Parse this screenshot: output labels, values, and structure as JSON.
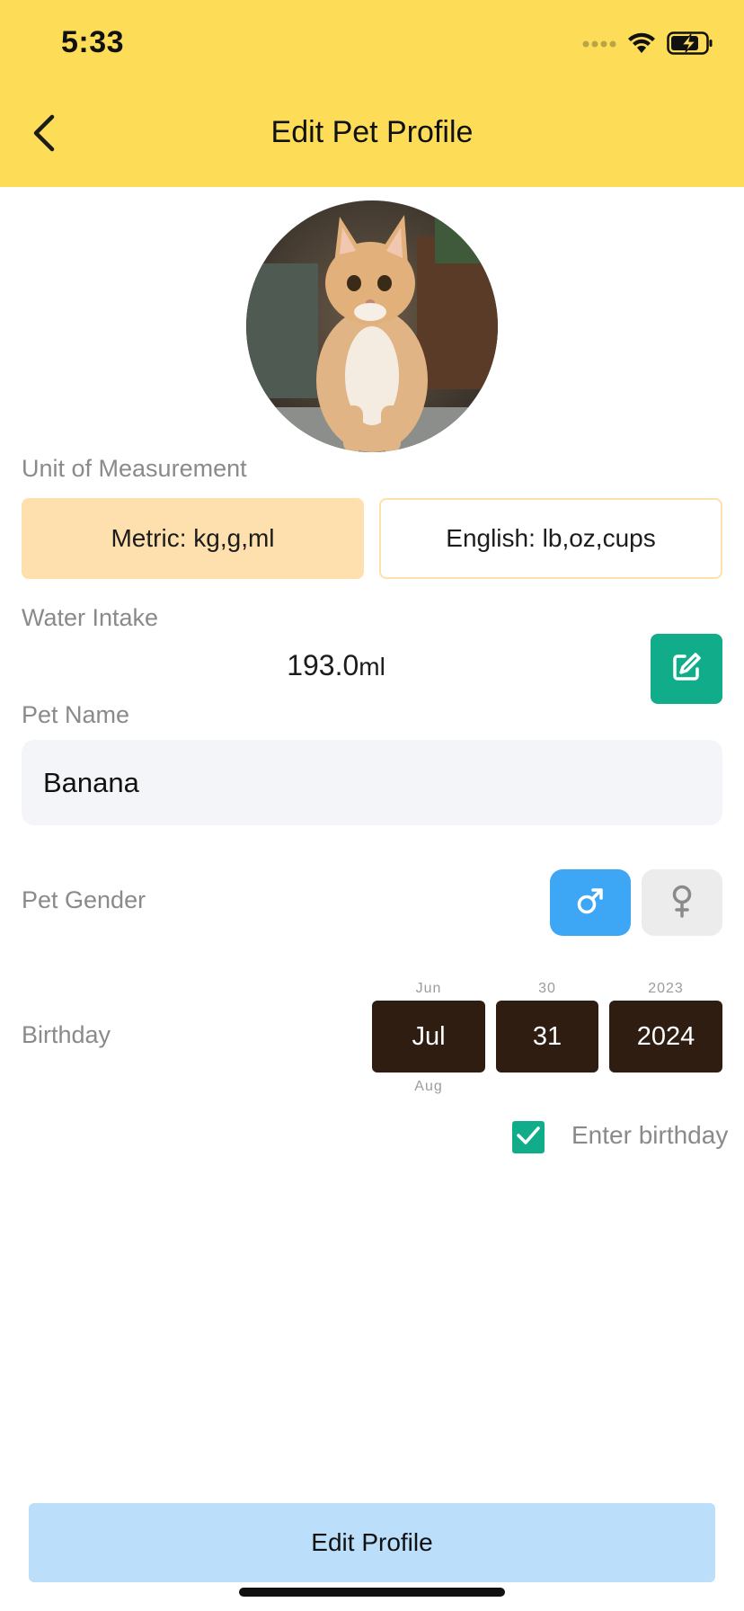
{
  "status_bar": {
    "time": "5:33",
    "icons": [
      "signal-dots-icon",
      "wifi-icon",
      "battery-charging-icon"
    ]
  },
  "header": {
    "title": "Edit Pet Profile",
    "back_icon": "chevron-left-icon",
    "background": "#fddd58"
  },
  "avatar": {
    "description_icon": "pet-photo"
  },
  "unit": {
    "label": "Unit of Measurement",
    "options": [
      "Metric: kg,g,ml",
      "English: lb,oz,cups"
    ],
    "selected": "Metric: kg,g,ml"
  },
  "water": {
    "label": "Water Intake",
    "value": "193.0",
    "unit": "ml",
    "edit_icon": "edit-pencil-icon"
  },
  "pet_name": {
    "label": "Pet Name",
    "value": "Banana"
  },
  "gender": {
    "label": "Pet Gender",
    "options": [
      "male",
      "female"
    ],
    "selected": "male"
  },
  "birthday": {
    "label": "Birthday",
    "month": {
      "prev": "Jun",
      "current": "Jul",
      "next": "Aug"
    },
    "day": {
      "prev": "30",
      "current": "31"
    },
    "year": {
      "prev": "2023",
      "current": "2024"
    }
  },
  "enter_birthday": {
    "label": "Enter birthday",
    "checked": true
  },
  "footer": {
    "button_label": "Edit Profile"
  },
  "colors": {
    "accent": "#fddd58",
    "teal": "#11ad8b",
    "male_blue": "#3ea7f5",
    "picker_dark": "#301d12",
    "button_blue": "#bbdefa"
  }
}
